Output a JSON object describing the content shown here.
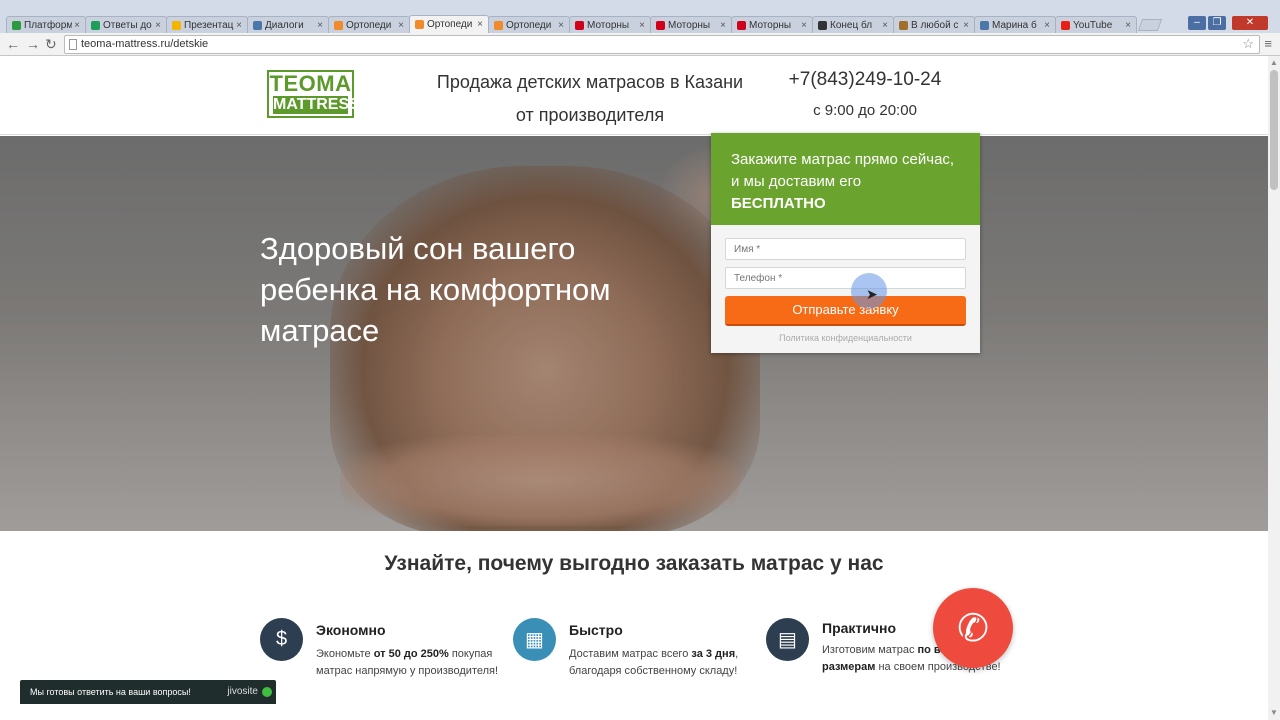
{
  "browser": {
    "tabs": [
      {
        "title": "Платформ",
        "favicon": "#2c9b3f",
        "active": false
      },
      {
        "title": "Ответы до",
        "favicon": "#1e9e5a",
        "active": false
      },
      {
        "title": "Презентац",
        "favicon": "#f4b400",
        "active": false
      },
      {
        "title": "Диалоги",
        "favicon": "#4a76a8",
        "active": false
      },
      {
        "title": "Ортопеди",
        "favicon": "#f08a2a",
        "active": false
      },
      {
        "title": "Ортопеди",
        "favicon": "#f08a2a",
        "active": true
      },
      {
        "title": "Ортопеди",
        "favicon": "#f08a2a",
        "active": false
      },
      {
        "title": "Моторны",
        "favicon": "#d0021b",
        "active": false
      },
      {
        "title": "Моторны",
        "favicon": "#d0021b",
        "active": false
      },
      {
        "title": "Моторны",
        "favicon": "#d0021b",
        "active": false
      },
      {
        "title": "Конец бл",
        "favicon": "#333333",
        "active": false
      },
      {
        "title": "В любой с",
        "favicon": "#a0702a",
        "active": false
      },
      {
        "title": "Марина б",
        "favicon": "#4a76a8",
        "active": false
      },
      {
        "title": "YouTube",
        "favicon": "#e62117",
        "active": false
      }
    ],
    "url": "teoma-mattress.ru/detskie"
  },
  "header": {
    "logo_top": "TEOMA",
    "logo_bottom": "MATTRESS",
    "tagline_line1": "Продажа детских матрасов в Казани",
    "tagline_line2": "от производителя",
    "phone": "+7(843)249-10-24",
    "hours": "с 9:00 до 20:00"
  },
  "hero": {
    "title": "Здоровый сон вашего ребенка на комфортном матрасе"
  },
  "form": {
    "heading": "Закажите матрас прямо сейчас, и мы доставим его",
    "heading_strong": "БЕСПЛАТНО",
    "name_placeholder": "Имя *",
    "phone_placeholder": "Телефон *",
    "submit_label": "Отправьте заявку",
    "policy_link": "Политика конфиденциальности"
  },
  "benefits": {
    "title": "Узнайте, почему выгодно заказать матрас у нас",
    "items": [
      {
        "title": "Экономно",
        "text_pre": "Экономьте ",
        "text_bold": "от 50 до 250%",
        "text_post": " покупая матрас напрямую у производителя!",
        "icon": "money-icon",
        "color": "#2c3e50"
      },
      {
        "title": "Быстро",
        "text_pre": "Доставим матрас всего ",
        "text_bold": "за 3 дня",
        "text_post": ", благодаря собственному складу!",
        "icon": "calendar-icon",
        "color": "#3a8fb7"
      },
      {
        "title": "Практично",
        "text_pre": "Изготовим матрас ",
        "text_bold": "по вашим размерам",
        "text_post": " на своем производстве!",
        "icon": "calculator-icon",
        "color": "#2c3e50"
      }
    ]
  },
  "widgets": {
    "chat_text": "Мы готовы ответить на ваши вопросы!",
    "chat_brand": "jivosite",
    "call_icon": "phone-icon"
  },
  "colors": {
    "brand_green": "#6aa32e",
    "cta_orange": "#f86b16",
    "call_red": "#ef4a3e"
  }
}
